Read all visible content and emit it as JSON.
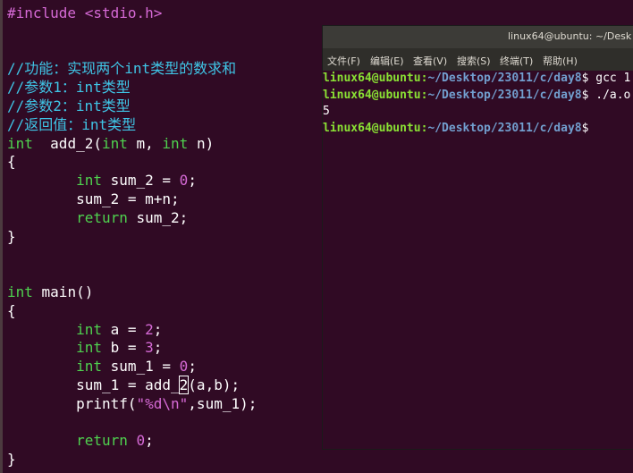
{
  "editor": {
    "lines": [
      {
        "segments": [
          {
            "t": "#include <stdio.h>",
            "c": "inc"
          }
        ]
      },
      {
        "segments": []
      },
      {
        "segments": []
      },
      {
        "segments": [
          {
            "t": "//功能：实现两个int类型的数求和",
            "c": "cmt"
          }
        ]
      },
      {
        "segments": [
          {
            "t": "//参数1：int类型",
            "c": "cmt"
          }
        ]
      },
      {
        "segments": [
          {
            "t": "//参数2：int类型",
            "c": "cmt"
          }
        ]
      },
      {
        "segments": [
          {
            "t": "//返回值：int类型",
            "c": "cmt"
          }
        ]
      },
      {
        "segments": [
          {
            "t": "int",
            "c": "kw"
          },
          {
            "t": "  add_2(",
            "c": ""
          },
          {
            "t": "int",
            "c": "kw"
          },
          {
            "t": " m, ",
            "c": ""
          },
          {
            "t": "int",
            "c": "kw"
          },
          {
            "t": " n)",
            "c": ""
          }
        ]
      },
      {
        "segments": [
          {
            "t": "{",
            "c": ""
          }
        ]
      },
      {
        "segments": [
          {
            "t": "        ",
            "c": ""
          },
          {
            "t": "int",
            "c": "kw"
          },
          {
            "t": " sum_2 = ",
            "c": ""
          },
          {
            "t": "0",
            "c": "num"
          },
          {
            "t": ";",
            "c": ""
          }
        ]
      },
      {
        "segments": [
          {
            "t": "        sum_2 = m+n;",
            "c": ""
          }
        ]
      },
      {
        "segments": [
          {
            "t": "        ",
            "c": ""
          },
          {
            "t": "return",
            "c": "kw"
          },
          {
            "t": " sum_2;",
            "c": ""
          }
        ]
      },
      {
        "segments": [
          {
            "t": "}",
            "c": ""
          }
        ]
      },
      {
        "segments": []
      },
      {
        "segments": []
      },
      {
        "segments": [
          {
            "t": "int",
            "c": "kw"
          },
          {
            "t": " main()",
            "c": ""
          }
        ]
      },
      {
        "segments": [
          {
            "t": "{",
            "c": ""
          }
        ]
      },
      {
        "segments": [
          {
            "t": "        ",
            "c": ""
          },
          {
            "t": "int",
            "c": "kw"
          },
          {
            "t": " a = ",
            "c": ""
          },
          {
            "t": "2",
            "c": "num"
          },
          {
            "t": ";",
            "c": ""
          }
        ]
      },
      {
        "segments": [
          {
            "t": "        ",
            "c": ""
          },
          {
            "t": "int",
            "c": "kw"
          },
          {
            "t": " b = ",
            "c": ""
          },
          {
            "t": "3",
            "c": "num"
          },
          {
            "t": ";",
            "c": ""
          }
        ]
      },
      {
        "segments": [
          {
            "t": "        ",
            "c": ""
          },
          {
            "t": "int",
            "c": "kw"
          },
          {
            "t": " sum_1 = ",
            "c": ""
          },
          {
            "t": "0",
            "c": "num"
          },
          {
            "t": ";",
            "c": ""
          }
        ]
      },
      {
        "segments": [
          {
            "t": "        sum_1 = add_",
            "c": ""
          },
          {
            "t": "2",
            "c": "cursor"
          },
          {
            "t": "(a,b);",
            "c": ""
          }
        ]
      },
      {
        "segments": [
          {
            "t": "        printf(",
            "c": ""
          },
          {
            "t": "\"%d\\n\"",
            "c": "str"
          },
          {
            "t": ",sum_1);",
            "c": ""
          }
        ]
      },
      {
        "segments": []
      },
      {
        "segments": [
          {
            "t": "        ",
            "c": ""
          },
          {
            "t": "return",
            "c": "kw"
          },
          {
            "t": " ",
            "c": ""
          },
          {
            "t": "0",
            "c": "num"
          },
          {
            "t": ";",
            "c": ""
          }
        ]
      },
      {
        "segments": [
          {
            "t": "}",
            "c": ""
          }
        ]
      }
    ]
  },
  "terminal": {
    "title": "linux64@ubuntu: ~/Desk",
    "menu": [
      "文件(F)",
      "编辑(E)",
      "查看(V)",
      "搜索(S)",
      "终端(T)",
      "帮助(H)"
    ],
    "lines": [
      {
        "user": "linux64@ubuntu",
        "path": "~/Desktop/23011/c/day8",
        "cmd": "$ gcc 1"
      },
      {
        "user": "linux64@ubuntu",
        "path": "~/Desktop/23011/c/day8",
        "cmd": "$ ./a.o"
      },
      {
        "output": "5"
      },
      {
        "user": "linux64@ubuntu",
        "path": "~/Desktop/23011/c/day8",
        "cmd": "$"
      }
    ]
  }
}
